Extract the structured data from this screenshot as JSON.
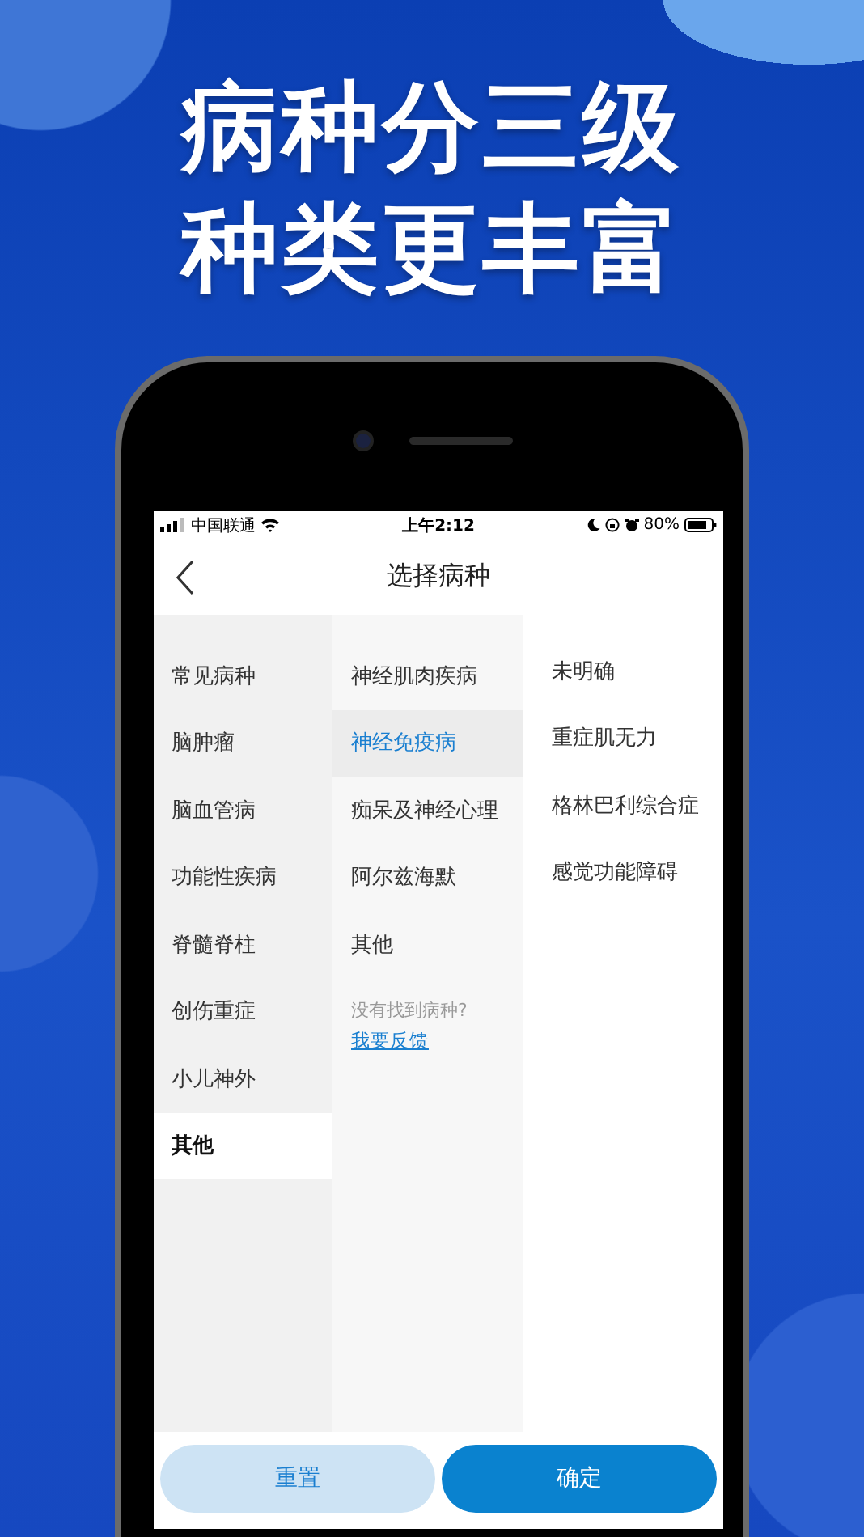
{
  "headline": [
    "病种分三级",
    "种类更丰富"
  ],
  "status_bar": {
    "carrier": "中国联通",
    "time": "上午2:12",
    "battery": "80%"
  },
  "nav": {
    "title": "选择病种"
  },
  "level_1": [
    {
      "label": "常见病种",
      "selected": false
    },
    {
      "label": "脑肿瘤",
      "selected": false
    },
    {
      "label": "脑血管病",
      "selected": false
    },
    {
      "label": "功能性疾病",
      "selected": false
    },
    {
      "label": "脊髓脊柱",
      "selected": false
    },
    {
      "label": "创伤重症",
      "selected": false
    },
    {
      "label": "小儿神外",
      "selected": false
    },
    {
      "label": "其他",
      "selected": true
    }
  ],
  "level_2": [
    {
      "label": "神经肌肉疾病",
      "selected": false
    },
    {
      "label": "神经免疫病",
      "selected": true
    },
    {
      "label": "痴呆及神经心理",
      "selected": false
    },
    {
      "label": "阿尔兹海默",
      "selected": false
    },
    {
      "label": "其他",
      "selected": false
    }
  ],
  "feedback": {
    "prompt": "没有找到病种?",
    "link": "我要反馈"
  },
  "level_3": [
    "未明确",
    "重症肌无力",
    "格林巴利综合症",
    "感觉功能障碍"
  ],
  "buttons": [
    {
      "label": "重置",
      "kind": "secondary"
    },
    {
      "label": "确定",
      "kind": "primary"
    }
  ]
}
